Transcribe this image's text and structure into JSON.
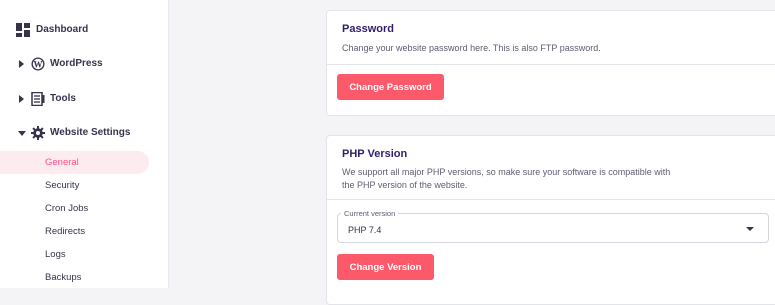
{
  "sidebar": {
    "dashboard": "Dashboard",
    "wordpress": "WordPress",
    "tools": "Tools",
    "website_settings": "Website Settings",
    "sub_items": [
      "General",
      "Security",
      "Cron Jobs",
      "Redirects",
      "Logs",
      "Backups"
    ]
  },
  "password_card": {
    "title": "Password",
    "description": "Change your website password here. This is also FTP password.",
    "button": "Change Password"
  },
  "php_card": {
    "title": "PHP Version",
    "description_line1": "We support all major PHP versions, so make sure your software is compatible with",
    "description_line2": "the PHP version of the website.",
    "select_label": "Current version",
    "select_value": "PHP 7.4",
    "button": "Change Version"
  },
  "colors": {
    "accent": "#fc5a6a",
    "active_text": "#fc5185",
    "active_bg": "#fdecef"
  }
}
